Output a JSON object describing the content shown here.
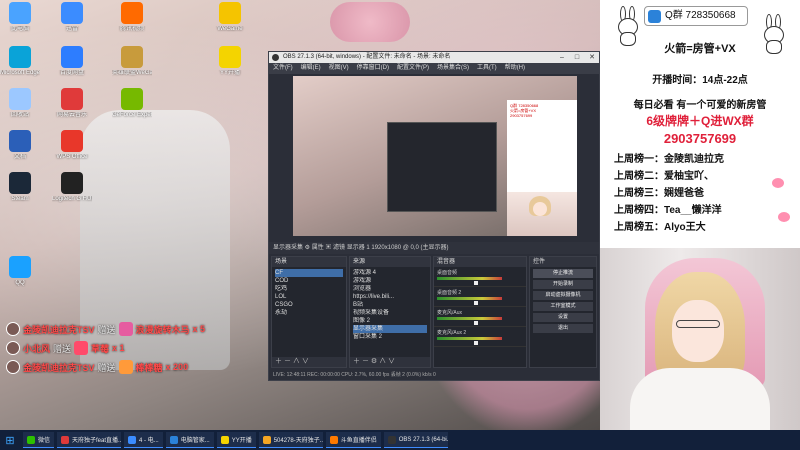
{
  "desktop": {
    "icons": [
      {
        "label": "此电脑",
        "icon": "computer-icon",
        "color": "#4aa3ff"
      },
      {
        "label": "迅雷",
        "icon": "thunder-icon",
        "color": "#3b8cff"
      },
      {
        "label": "腾讯视频",
        "icon": "tencent-video-icon",
        "color": "#ff6a00"
      },
      {
        "label": "WeGame",
        "icon": "wegame-icon",
        "color": "#f5c400"
      },
      {
        "label": "Microsoft Edge",
        "icon": "edge-icon",
        "color": "#0aa3d8"
      },
      {
        "label": "百度网盘",
        "icon": "baidu-netdisk-icon",
        "color": "#2d7dff"
      },
      {
        "label": "英雄联盟WeGame版",
        "icon": "lol-wegame-icon",
        "color": "#c89b3c"
      },
      {
        "label": "YY开播",
        "icon": "yy-icon",
        "color": "#f4d400"
      },
      {
        "label": "回收站",
        "icon": "recycle-bin-icon",
        "color": "#9cc8ff"
      },
      {
        "label": "网易云音乐",
        "icon": "netease-music-icon",
        "color": "#e03a3a"
      },
      {
        "label": "GeForce Experience",
        "icon": "geforce-icon",
        "color": "#76b900"
      },
      {
        "label": "文档",
        "icon": "word-icon",
        "color": "#2b5fb8"
      },
      {
        "label": "WPS Office",
        "icon": "wps-icon",
        "color": "#e8372a"
      },
      {
        "label": "Steam",
        "icon": "steam-icon",
        "color": "#1b2838"
      },
      {
        "label": "Logitech G HUB",
        "icon": "ghub-icon",
        "color": "#222222"
      },
      {
        "label": "QQ",
        "icon": "qq-icon",
        "color": "#1aa1ff"
      }
    ]
  },
  "danmaku": [
    {
      "user": "金陵凯迪拉克TSV",
      "action": "赠送",
      "gift": "浪漫旋转木马",
      "count": "x 5"
    },
    {
      "user": "小北风",
      "action": "赠送",
      "gift": "草莓",
      "count": "x 1"
    },
    {
      "user": "金陵凯迪拉克TSV",
      "action": "赠送",
      "gift": "棒棒糖",
      "count": "x 200"
    }
  ],
  "obs": {
    "title": "OBS 27.1.3 (64-bit, windows) - 配置文件: 未命名 - 场景: 未命名",
    "menu": [
      "文件(F)",
      "编辑(E)",
      "视图(V)",
      "停靠窗口(D)",
      "配置文件(P)",
      "场景集合(S)",
      "工具(T)",
      "帮助(H)"
    ],
    "dock_bar": "显示器采集      ⚙ 属性   ▣ 滤镜   显示器  1  1920x1080 @ 0,0 (主显示器)",
    "docks": {
      "scenes": {
        "title": "场景",
        "items": [
          "CF",
          "COD",
          "吃鸡",
          "LOL",
          "CSGO",
          "永劫"
        ]
      },
      "sources": {
        "title": "来源",
        "items": [
          "游戏源 4",
          "游戏源",
          "浏览器",
          "https://live.bili...",
          "B站",
          "视频采集设备",
          "图像 2",
          "显示器采集",
          "窗口采集 2"
        ]
      },
      "mixer": {
        "title": "混音器",
        "channels": [
          "桌面音频",
          "桌面音频 2",
          "麦克风/Aux",
          "麦克风/Aux 2"
        ]
      },
      "controls": {
        "title": "控件",
        "buttons": [
          "停止推流",
          "开始录制",
          "启动虚拟摄像机",
          "工作室模式",
          "设置",
          "退出"
        ]
      }
    },
    "status": "LIVE: 12:48:11   REC: 00:00:00   CPU: 2.7%, 60.00 fps   丢帧 2 (0.0%)   kb/s 0"
  },
  "info_panel": {
    "qq_group": "Q群 728350668",
    "rocket": "火箭=房管+VX",
    "stream_time": "开播时间：14点-22点",
    "welcome": "每日必看 有一个可爱的新房管",
    "badge": "6级牌牌＋Q进WX群",
    "group_number": "2903757699",
    "ranks": [
      "上周榜一：金陵凯迪拉克",
      "上周榜二：爱柚宝吖、",
      "上周榜三：娴娌爸爸",
      "上周榜四：Tea__懒洋洋",
      "上周榜五：Alyo王大"
    ]
  },
  "taskbar": {
    "items": [
      {
        "label": "微信",
        "color": "#2dc100"
      },
      {
        "label": "天府独子feat直播...",
        "color": "#e03a3a"
      },
      {
        "label": "4 - 电...",
        "color": "#3b8cff"
      },
      {
        "label": "电脑管家...",
        "color": "#2b82d9"
      },
      {
        "label": "YY开播",
        "color": "#f4d400"
      },
      {
        "label": "504278-天府独子...",
        "color": "#f5a623"
      },
      {
        "label": "斗鱼直播伴侣",
        "color": "#ff7a00"
      },
      {
        "label": "OBS 27.1.3 (64-bi...",
        "color": "#333333"
      }
    ]
  }
}
